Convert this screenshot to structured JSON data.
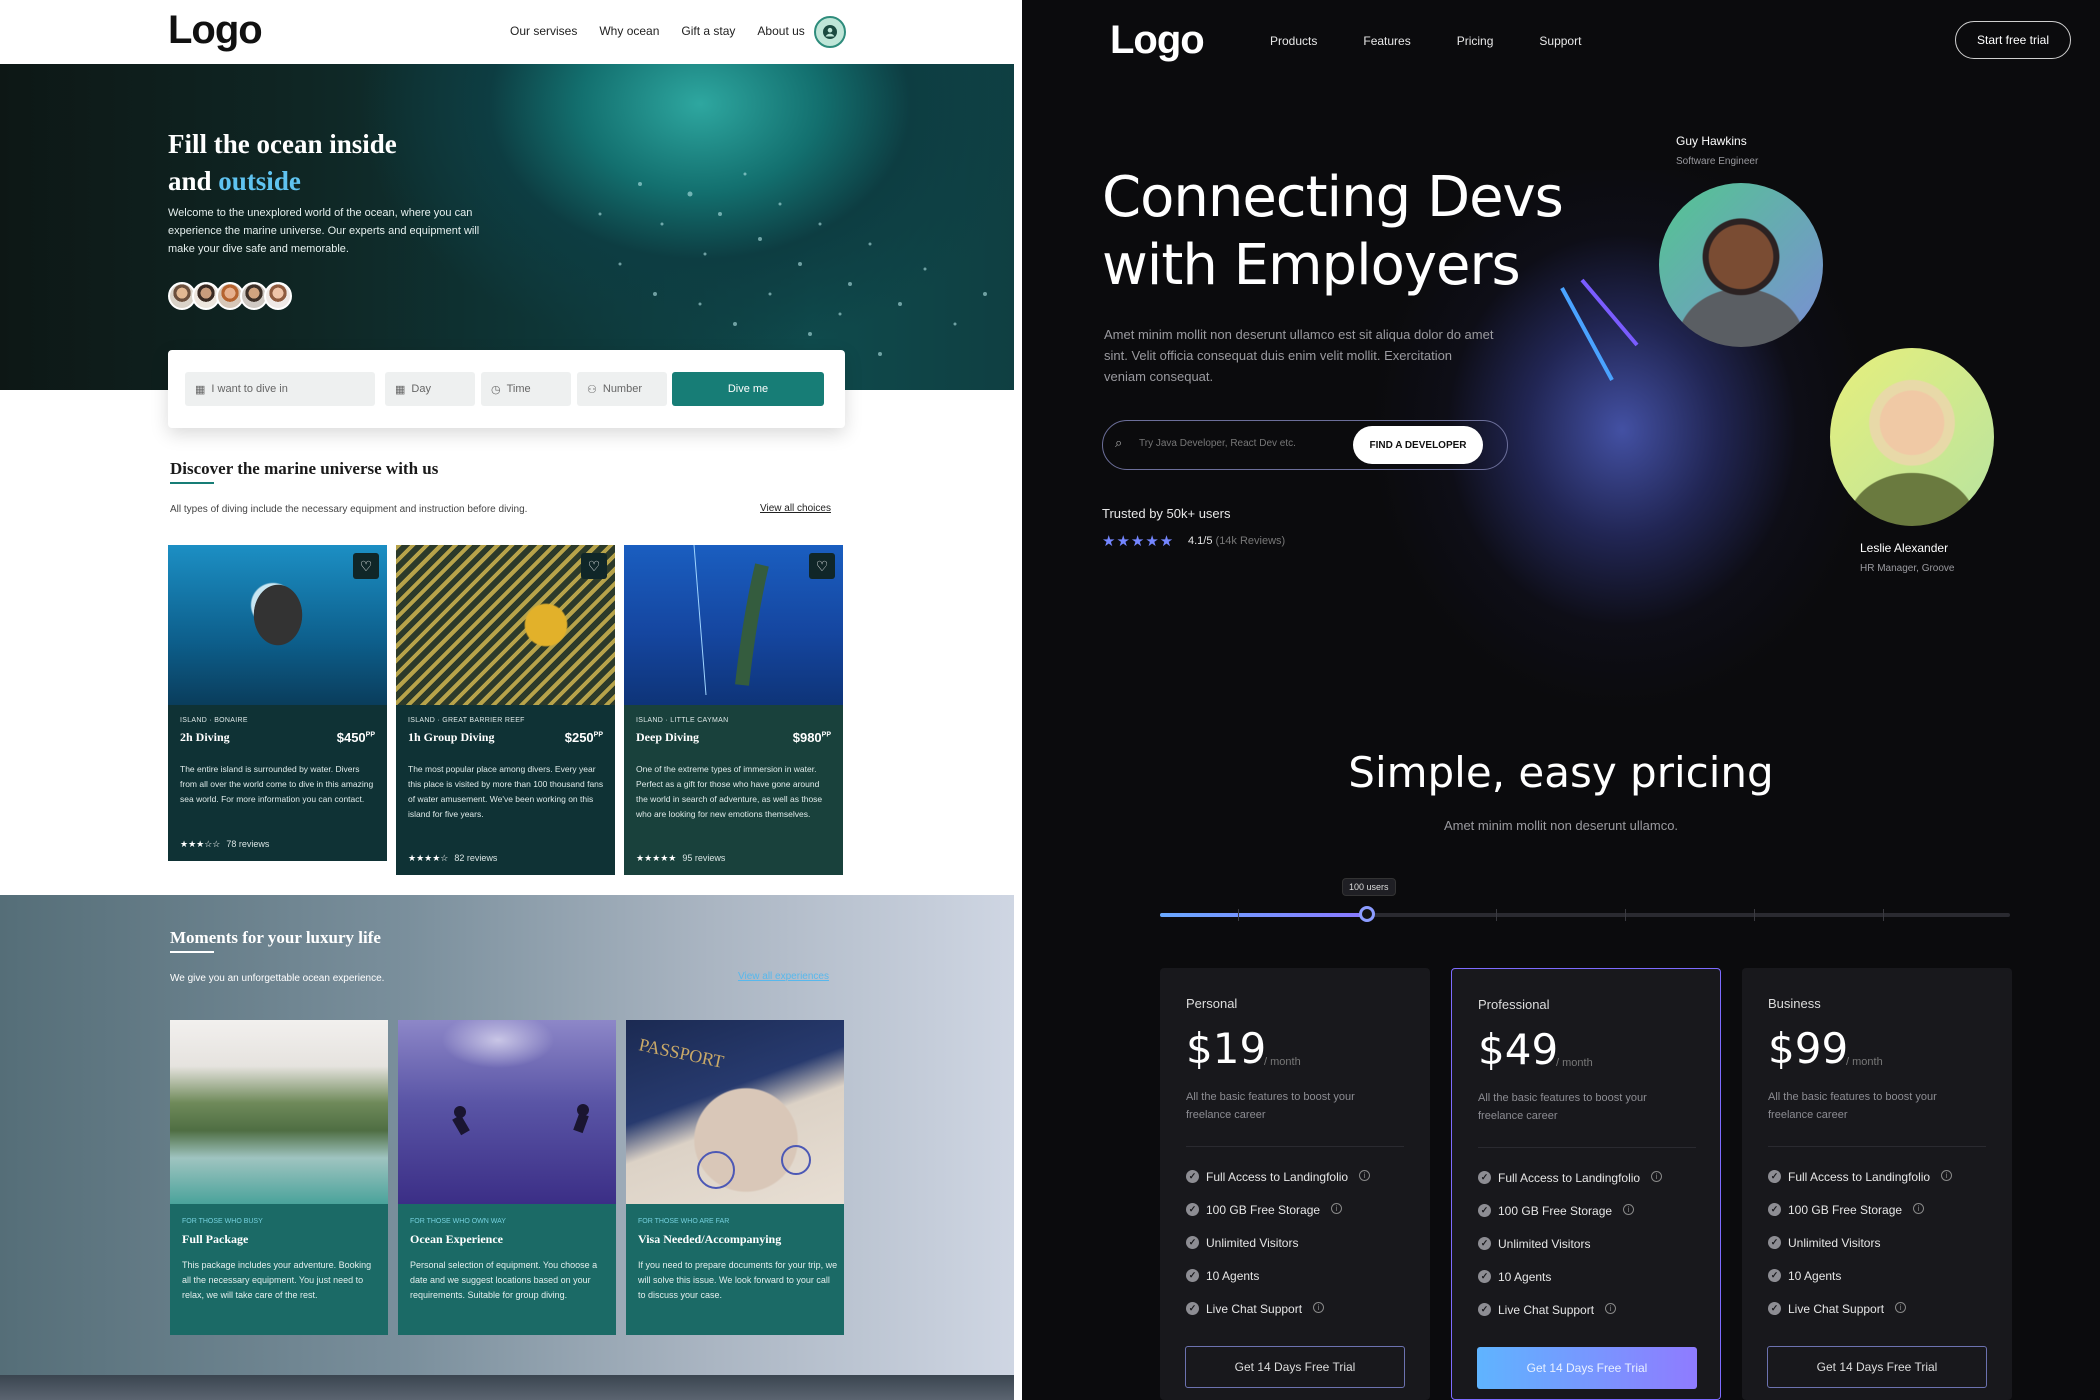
{
  "left": {
    "logo": "Logo",
    "nav": [
      "Our servises",
      "Why ocean",
      "Gift a stay",
      "About us"
    ],
    "hero": {
      "title_line1": "Fill the ocean inside",
      "title_line2_a": "and ",
      "title_line2_b": "outside",
      "description": "Welcome to the unexplored world of the ocean, where you can experience the marine universe. Our experts and equipment will make your dive safe and memorable."
    },
    "search": {
      "dive_placeholder": "I want to dive in",
      "day_placeholder": "Day",
      "time_placeholder": "Time",
      "number_placeholder": "Number",
      "button": "Dive me"
    },
    "discover": {
      "title": "Discover the marine universe with us",
      "subtitle": "All types of diving include the necessary equipment and instruction before diving.",
      "link": "View all choices",
      "cards": [
        {
          "tag": "ISLAND · BONAIRE",
          "title": "2h Diving",
          "price": "$450",
          "unit": "PP",
          "desc": "The entire island is surrounded by water. Divers from all over the world come to dive in this amazing sea world. For more information you can contact.",
          "rating": 3,
          "reviews": "78 reviews"
        },
        {
          "tag": "ISLAND · GREAT BARRIER REEF",
          "title": "1h Group Diving",
          "price": "$250",
          "unit": "PP",
          "desc": "The most popular place among divers. Every year this place is visited by more than 100 thousand fans of water amusement. We've been working on this island for five years.",
          "rating": 4,
          "reviews": "82 reviews"
        },
        {
          "tag": "ISLAND · LITTLE CAYMAN",
          "title": "Deep Diving",
          "price": "$980",
          "unit": "PP",
          "desc": "One of the extreme types of immersion in water. Perfect as a gift for those who have gone around the world in search of adventure, as well as those who are looking for new emotions themselves.",
          "rating": 5,
          "reviews": "95 reviews"
        }
      ]
    },
    "moments": {
      "title": "Moments for your luxury life",
      "subtitle": "We give you an unforgettable ocean experience.",
      "link": "View all experiences",
      "cards": [
        {
          "tag": "FOR THOSE WHO BUSY",
          "title": "Full Package",
          "desc": "This package includes your adventure. Booking all the necessary equipment. You just need to relax, we will take care of the rest."
        },
        {
          "tag": "FOR THOSE WHO OWN WAY",
          "title": "Ocean Experience",
          "desc": "Personal selection of equipment. You choose a date and we suggest locations based on your requirements. Suitable for group diving."
        },
        {
          "tag": "FOR THOSE WHO ARE FAR",
          "title": "Visa Needed/Accompanying",
          "desc": "If you need to prepare documents for your trip, we will solve this issue. We look forward to your call to discuss your case."
        }
      ]
    }
  },
  "right": {
    "logo": "Logo",
    "nav": [
      "Products",
      "Features",
      "Pricing",
      "Support"
    ],
    "cta": "Start free trial",
    "hero": {
      "title_line1": "Connecting Devs",
      "title_line2": "with Employers",
      "description": "Amet minim mollit non deserunt ullamco est sit aliqua dolor do amet sint. Velit officia consequat duis enim velit mollit. Exercitation veniam consequat.",
      "search_placeholder": "Try Java Developer, React Dev etc.",
      "search_button": "FIND A DEVELOPER",
      "trusted": "Trusted by 50k+ users",
      "rating": "4.1/5",
      "reviews": "(14k Reviews)",
      "stars": "★★★★★"
    },
    "people": [
      {
        "name": "Guy Hawkins",
        "role": "Software Engineer"
      },
      {
        "name": "Leslie Alexander",
        "role": "HR Manager, Groove"
      }
    ],
    "pricing": {
      "title": "Simple, easy pricing",
      "subtitle": "Amet minim mollit non deserunt ullamco.",
      "slider_label": "100 users",
      "slider_fraction": 0.243,
      "plans": [
        {
          "name": "Personal",
          "price": "$19",
          "period": "/ month",
          "desc": "All the basic features to boost your freelance career",
          "button": "Get 14 Days Free Trial"
        },
        {
          "name": "Professional",
          "price": "$49",
          "period": "/ month",
          "desc": "All the basic features to boost your freelance career",
          "button": "Get 14 Days Free Trial"
        },
        {
          "name": "Business",
          "price": "$99",
          "period": "/ month",
          "desc": "All the basic features to boost your freelance career",
          "button": "Get 14 Days Free Trial"
        }
      ],
      "features": [
        "Full Access to Landingfolio",
        "100 GB Free Storage",
        "Unlimited Visitors",
        "10 Agents",
        "Live Chat Support"
      ],
      "features_with_info": [
        true,
        true,
        false,
        false,
        true
      ]
    },
    "colors": {
      "accent": "#7486ff",
      "pro_border": "#7d6bff",
      "teal": "#177d76"
    }
  }
}
